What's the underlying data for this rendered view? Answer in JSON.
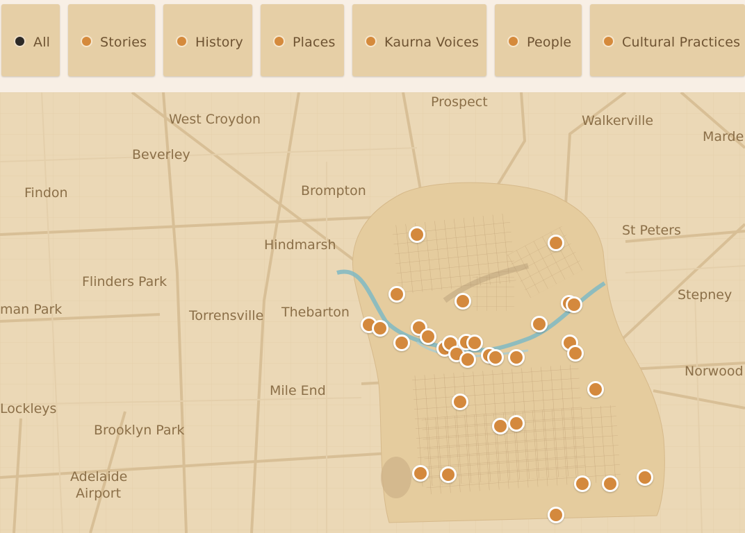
{
  "filters": [
    {
      "label": "All",
      "active": true
    },
    {
      "label": "Stories",
      "active": false
    },
    {
      "label": "History",
      "active": false
    },
    {
      "label": "Places",
      "active": false
    },
    {
      "label": "Kaurna Voices",
      "active": false
    },
    {
      "label": "People",
      "active": false
    },
    {
      "label": "Cultural Practices",
      "active": false
    }
  ],
  "places": [
    "Prospect",
    "West Croydon",
    "Walkerville",
    "Marde",
    "Beverley",
    "Findon",
    "Brompton",
    "St Peters",
    "Hindmarsh",
    "Flinders Park",
    "Stepney",
    "man Park",
    "Torrensville",
    "Thebarton",
    "Norwood",
    "Mile End",
    "Lockleys",
    "Brooklyn Park",
    "Adelaide",
    "Airport"
  ],
  "colors": {
    "chip_bg": "#e6cfa6",
    "chip_text": "#6e5332",
    "active_dot": "#2d2a27",
    "marker": "#d4893d",
    "map_base": "#ebd8b6",
    "river": "#7fb9c3"
  },
  "icons": {
    "filter_dot": "circle-dot-icon",
    "marker": "map-pin-circle-icon"
  }
}
